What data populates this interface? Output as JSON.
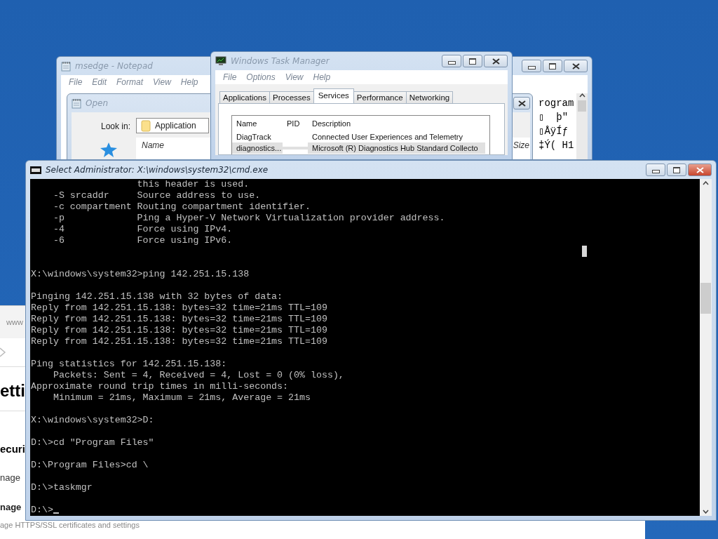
{
  "notepad": {
    "title": "msedge - Notepad",
    "menu": [
      "File",
      "Edit",
      "Format",
      "View",
      "Help"
    ],
    "text_lines": [
      "rogram",
      "▯  þ\"",
      "▯ÅÿÍƒ",
      "‡Ý( H1"
    ]
  },
  "open_dialog": {
    "title": "Open",
    "look_in_label": "Look in:",
    "look_in_value": "Application",
    "columns": [
      "Name",
      "Size"
    ]
  },
  "task_manager": {
    "title": "Windows Task Manager",
    "menu": [
      "File",
      "Options",
      "View",
      "Help"
    ],
    "tabs": [
      {
        "label": "Applications",
        "selected": false
      },
      {
        "label": "Processes",
        "selected": false
      },
      {
        "label": "Services",
        "selected": true
      },
      {
        "label": "Performance",
        "selected": false
      },
      {
        "label": "Networking",
        "selected": false
      }
    ],
    "columns": [
      "Name",
      "PID",
      "Description"
    ],
    "rows": [
      {
        "name": "DiagTrack",
        "description": "Connected User Experiences and Telemetry",
        "selected": false
      },
      {
        "name": "diagnostics...",
        "description": "Microsoft (R) Diagnostics Hub Standard Collecto",
        "selected": true
      }
    ]
  },
  "browser": {
    "address": "www",
    "heading": "etti",
    "section_title": "ecuri",
    "section_text": "nage",
    "link_title": "nage",
    "link_text": "age HTTPS/SSL certificates and settings"
  },
  "console": {
    "title": "Select Administrator: X:\\windows\\system32\\cmd.exe",
    "blocks": [
      {
        "lines": [
          "                   this header is used.",
          "    -S srcaddr     Source address to use.",
          "    -c compartment Routing compartment identifier.",
          "    -p             Ping a Hyper-V Network Virtualization provider address.",
          "    -4             Force using IPv4.",
          "    -6             Force using IPv6."
        ]
      },
      {
        "lines": [
          "X:\\windows\\system32>ping 142.251.15.138"
        ]
      },
      {
        "lines": [
          "Pinging 142.251.15.138 with 32 bytes of data:",
          "Reply from 142.251.15.138: bytes=32 time=21ms TTL=109",
          "Reply from 142.251.15.138: bytes=32 time=21ms TTL=109",
          "Reply from 142.251.15.138: bytes=32 time=21ms TTL=109",
          "Reply from 142.251.15.138: bytes=32 time=21ms TTL=109"
        ]
      },
      {
        "lines": [
          "Ping statistics for 142.251.15.138:",
          "    Packets: Sent = 4, Received = 4, Lost = 0 (0% loss),",
          "Approximate round trip times in milli-seconds:",
          "    Minimum = 21ms, Maximum = 21ms, Average = 21ms"
        ]
      },
      {
        "lines": [
          "X:\\windows\\system32>D:"
        ]
      },
      {
        "lines": [
          "D:\\>cd \"Program Files\""
        ]
      },
      {
        "lines": [
          "D:\\Program Files>cd \\"
        ]
      },
      {
        "lines": [
          "D:\\>taskmgr"
        ]
      },
      {
        "lines": [
          "D:\\>"
        ]
      }
    ]
  }
}
